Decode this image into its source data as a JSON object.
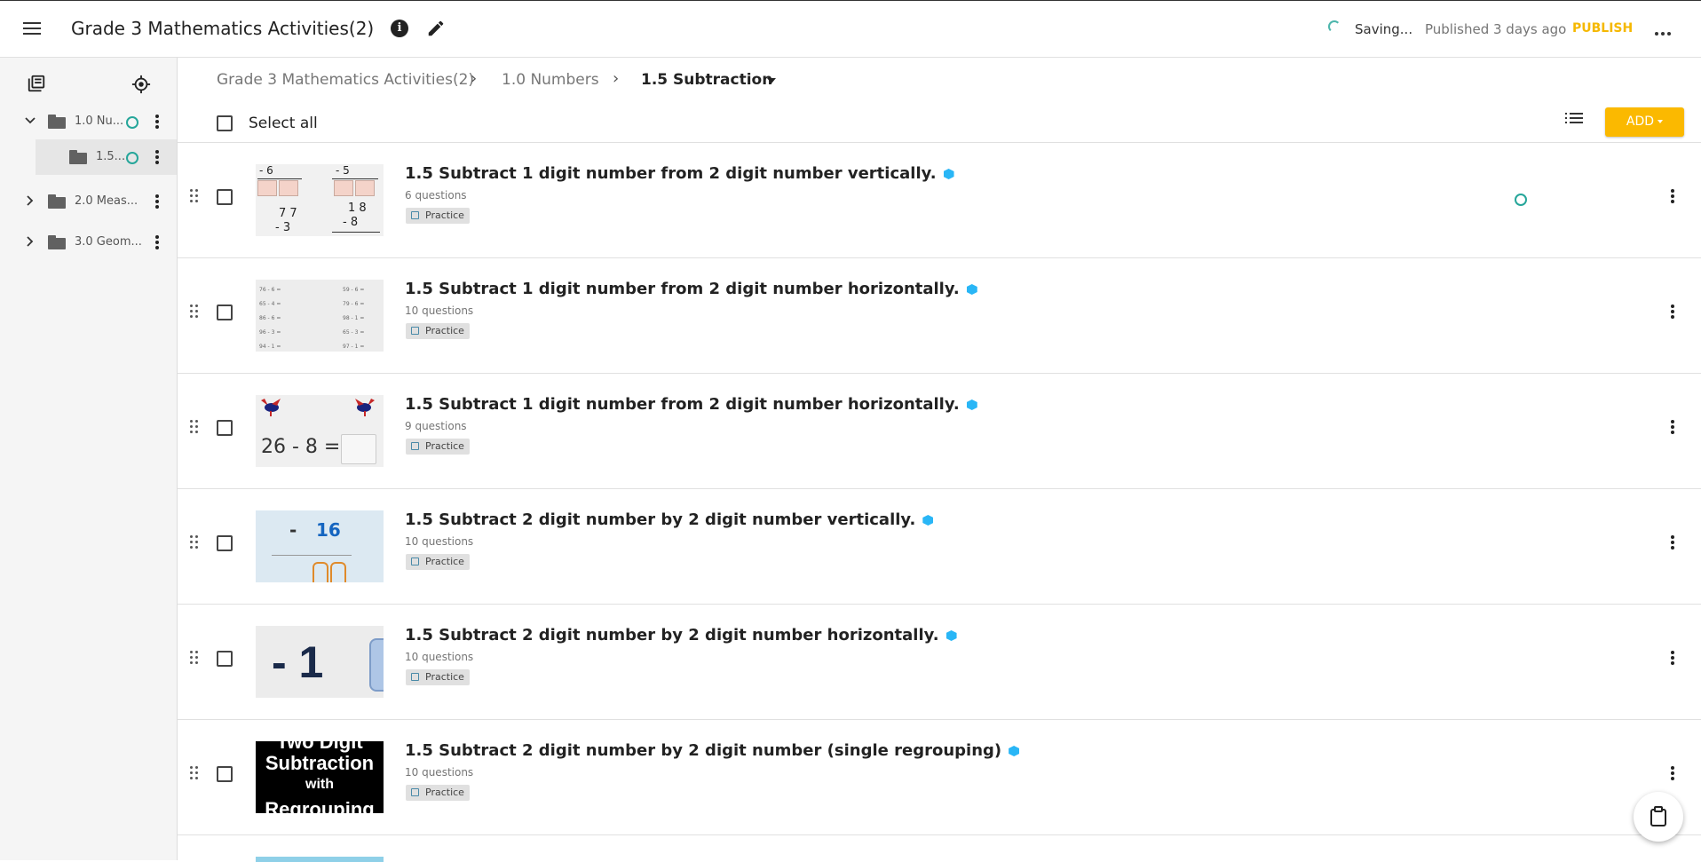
{
  "header": {
    "title": "Grade 3 Mathematics Activities(2)",
    "saving": "Saving...",
    "published": "Published 3 days ago",
    "publish_label": "PUBLISH",
    "icons": [
      "menu-icon",
      "info-icon",
      "edit-icon",
      "more-horizontal-icon"
    ]
  },
  "sidebar": {
    "icons": [
      "copy-icon",
      "locate-icon"
    ],
    "tree": [
      {
        "label": "1.0 Nu...",
        "expanded": true,
        "status": "ring"
      },
      {
        "label": "1.5...",
        "selected": true,
        "status": "ring"
      },
      {
        "label": "2.0 Meas...",
        "expanded": false
      },
      {
        "label": "3.0 Geom...",
        "expanded": false
      }
    ]
  },
  "breadcrumb": {
    "items": [
      "Grade 3 Mathematics Activities(2)",
      "1.0 Numbers"
    ],
    "current": "1.5 Subtraction"
  },
  "toolbar": {
    "select_all": "Select all",
    "add_label": "ADD",
    "accent": "#fbb900"
  },
  "rows": [
    {
      "title": "1.5 Subtract 1 digit number from 2 digit number vertically.",
      "count": "6 questions",
      "badge": "Practice",
      "thumb": "vertical-1"
    },
    {
      "title": "1.5 Subtract 1 digit number from 2 digit number horizontally.",
      "count": "10 questions",
      "badge": "Practice",
      "thumb": "horizontal-list"
    },
    {
      "title": "1.5 Subtract 1 digit number from 2 digit number horizontally.",
      "count": "9 questions",
      "badge": "Practice",
      "thumb": "birds"
    },
    {
      "title": "1.5 Subtract 2 digit number by 2 digit number vertically.",
      "count": "10 questions",
      "badge": "Practice",
      "thumb": "blue-16"
    },
    {
      "title": "1.5 Subtract 2 digit number by 2 digit number horizontally.",
      "count": "10 questions",
      "badge": "Practice",
      "thumb": "minus-1"
    },
    {
      "title": "1.5 Subtract 2 digit number by 2 digit number (single regrouping)",
      "count": "10 questions",
      "badge": "Practice",
      "thumb": "black-title"
    }
  ],
  "thumb_text": {
    "vertical_1": {
      "a": "- 6",
      "b": "- 5",
      "c": "7 7",
      "d": "- 3",
      "e": "1 8",
      "f": "- 8"
    },
    "horizontal_list": {
      "left": [
        "76 - 6 =",
        "65 - 4 =",
        "86 - 6 =",
        "96 - 3 =",
        "94 - 1 ="
      ],
      "right": [
        "59 - 6 =",
        "79 - 6 =",
        "98 - 1 =",
        "65 - 3 =",
        "97 - 1 ="
      ]
    },
    "birds": {
      "eq": "26 - 8 ="
    },
    "blue_16": {
      "minus": "-",
      "num": "16"
    },
    "minus_1": {
      "text": "- 1"
    },
    "black_title": {
      "l1": "Two Digit",
      "l2": "Subtraction",
      "l3": "with",
      "l4": "Regrouping"
    }
  }
}
